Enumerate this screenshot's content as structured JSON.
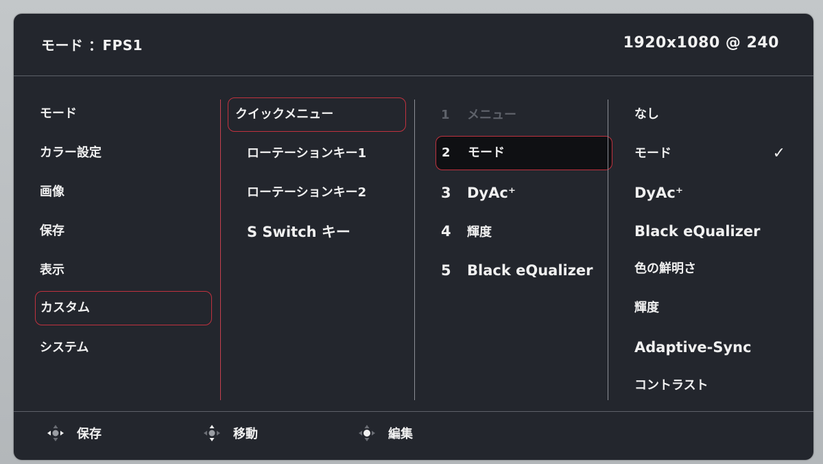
{
  "header": {
    "mode_label": "モード ：FPS1",
    "resolution": "1920x1080 @ 240"
  },
  "column1": {
    "items": [
      "モード",
      "カラー設定",
      "画像",
      "保存",
      "表示",
      "カスタム",
      "システム"
    ],
    "selected_index": 5
  },
  "column2": {
    "items": [
      "クイックメニュー",
      "ローテーションキー1",
      "ローテーションキー2",
      "S Switch キー"
    ],
    "selected_index": 0
  },
  "column3": {
    "items": [
      {
        "num": "1",
        "label": "メニュー"
      },
      {
        "num": "2",
        "label": "モード"
      },
      {
        "num": "3",
        "label": "DyAc⁺"
      },
      {
        "num": "4",
        "label": "輝度"
      },
      {
        "num": "5",
        "label": "Black eQualizer"
      }
    ],
    "active_index": 1,
    "disabled_index": 0
  },
  "column4": {
    "items": [
      "なし",
      "モード",
      "DyAc⁺",
      "Black eQualizer",
      "色の鮮明さ",
      "輝度",
      "Adaptive-Sync",
      "コントラスト"
    ],
    "checked_index": 1,
    "check_glyph": "✓"
  },
  "footer": {
    "hints": [
      {
        "icon": "joystick-left-right-icon",
        "label": "保存"
      },
      {
        "icon": "joystick-up-down-icon",
        "label": "移動"
      },
      {
        "icon": "joystick-press-icon",
        "label": "編集"
      }
    ]
  },
  "colors": {
    "background": "#23262d",
    "accent_red": "#c2323f",
    "divider": "#8c8f96",
    "text": "#f0f0f0",
    "dim_text": "#5e626a"
  }
}
